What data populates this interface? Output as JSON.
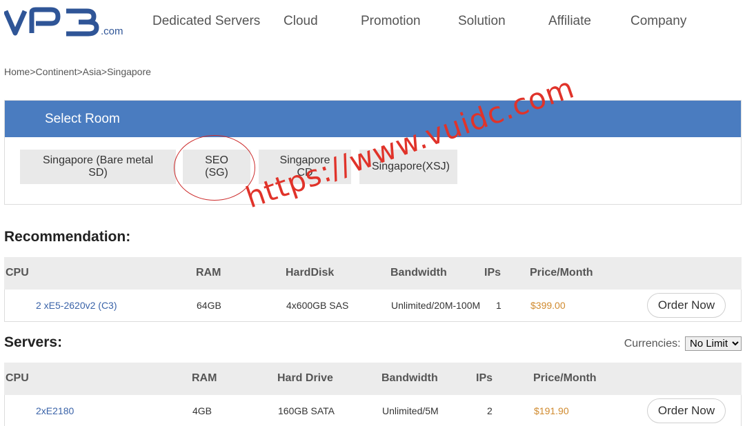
{
  "header": {
    "logo_text": "VPS",
    "logo_suffix": ".com",
    "nav": [
      "Dedicated Servers",
      "Cloud",
      "Promotion",
      "Solution",
      "Affiliate",
      "Company"
    ]
  },
  "breadcrumb": [
    "Home",
    "Continent",
    "Asia",
    "Singapore"
  ],
  "breadcrumb_separator": ">",
  "room": {
    "title": "Select Room",
    "options": [
      "Singapore (Bare metal SD)",
      "SEO (SG)",
      "Singapore CD",
      "Singapore(XSJ)"
    ]
  },
  "recommendation": {
    "title": "Recommendation:",
    "columns": [
      "CPU",
      "RAM",
      "HardDisk",
      "Bandwidth",
      "IPs",
      "Price/Month"
    ],
    "rows": [
      {
        "cpu": "2 xE5-2620v2 (C3)",
        "ram": "64GB",
        "disk": "4x600GB SAS",
        "bandwidth": "Unlimited/20M-100M",
        "ips": "1",
        "price": "$399.00",
        "action": "Order Now"
      }
    ]
  },
  "servers": {
    "title": "Servers:",
    "currency_label": "Currencies:",
    "currency_value": "No Limit",
    "columns": [
      "CPU",
      "RAM",
      "Hard Drive",
      "Bandwidth",
      "IPs",
      "Price/Month"
    ],
    "rows": [
      {
        "cpu": "2xE2180",
        "ram": "4GB",
        "disk": "160GB SATA",
        "bandwidth": "Unlimited/5M",
        "ips": "2",
        "price": "$191.90",
        "action": "Order Now"
      }
    ]
  },
  "watermark": "https://www.vuidc.com",
  "colors": {
    "header_bar": "#4a7cc0",
    "link_blue": "#3a63a8",
    "price_orange": "#d08a2e",
    "annotation_red": "#cc2a2a"
  }
}
